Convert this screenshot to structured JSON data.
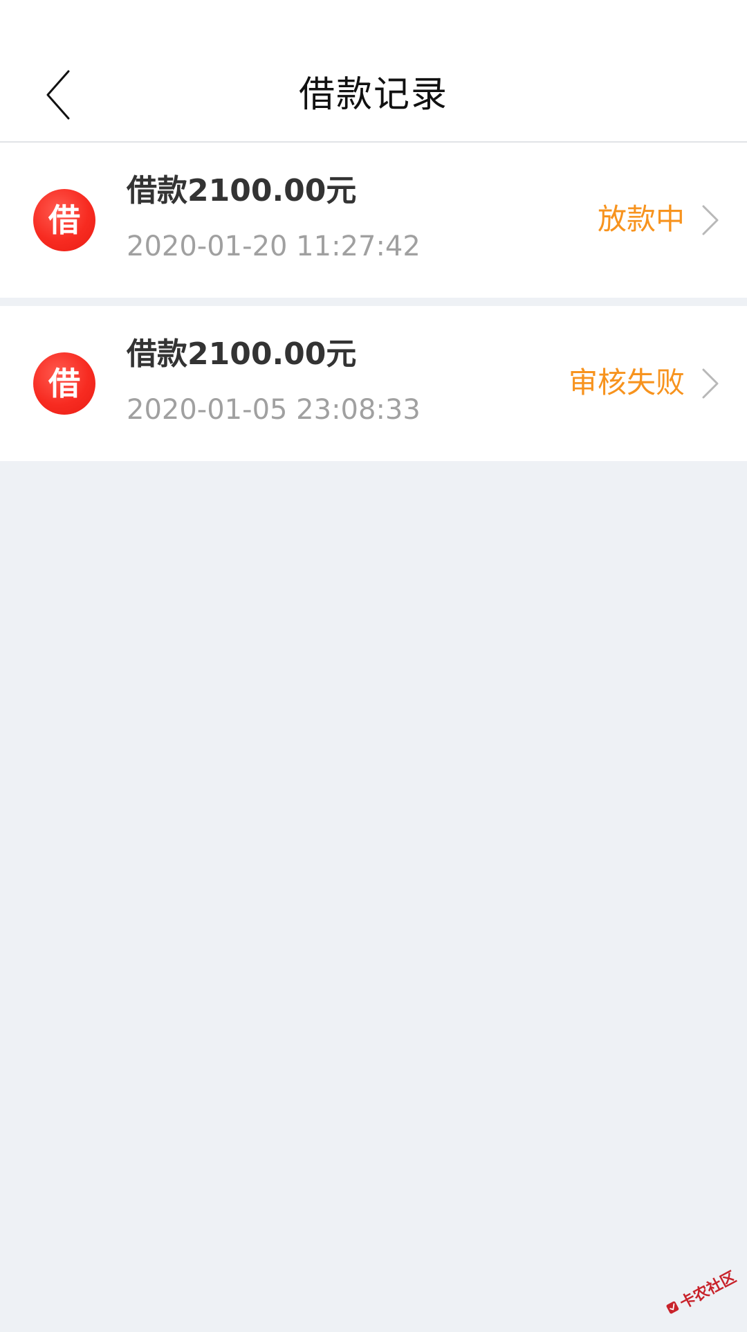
{
  "header": {
    "title": "借款记录",
    "back_icon": "chevron-left-icon"
  },
  "records": [
    {
      "badge": "借",
      "amount": "借款2100.00元",
      "date": "2020-01-20 11:27:42",
      "status": "放款中",
      "status_color": "#f7931e"
    },
    {
      "badge": "借",
      "amount": "借款2100.00元",
      "date": "2020-01-05 23:08:33",
      "status": "审核失败",
      "status_color": "#f7931e"
    }
  ],
  "watermark": {
    "text": "卡农社区"
  },
  "colors": {
    "accent": "#f7931e",
    "badge_red": "#f72b21",
    "background": "#eef1f5"
  }
}
